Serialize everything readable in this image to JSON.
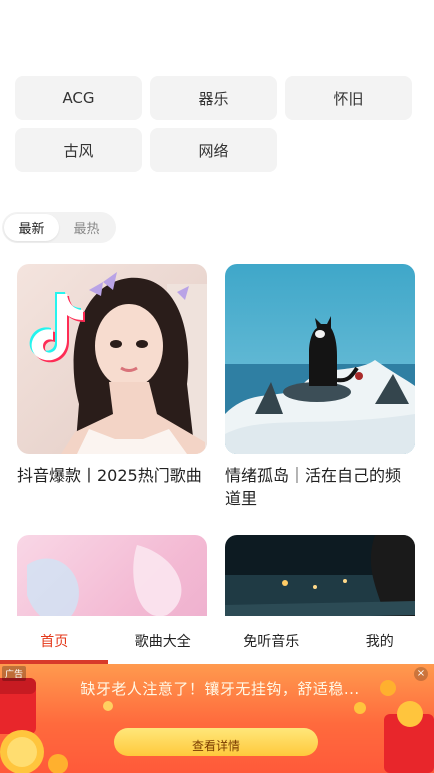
{
  "genres": [
    "ACG",
    "器乐",
    "怀旧",
    "古风",
    "网络"
  ],
  "sort": {
    "options": [
      "最新",
      "最热"
    ],
    "selected": "最新"
  },
  "playlists": [
    {
      "title": "抖音爆款丨2025热门歌曲"
    },
    {
      "title": "情绪孤岛｜活在自己的频道里"
    },
    {
      "title": ""
    },
    {
      "title": ""
    }
  ],
  "nav": {
    "tabs": [
      "首页",
      "歌曲大全",
      "免听音乐",
      "我的"
    ],
    "active": "首页"
  },
  "ad": {
    "badge": "广告",
    "headline": "缺牙老人注意了！镶牙无挂钩，舒适稳...",
    "cta": "查看详情",
    "close": "×"
  },
  "colors": {
    "accent": "#e4391b",
    "chip_bg": "#f3f3f3",
    "ad_orange": "#ff6a3d"
  }
}
